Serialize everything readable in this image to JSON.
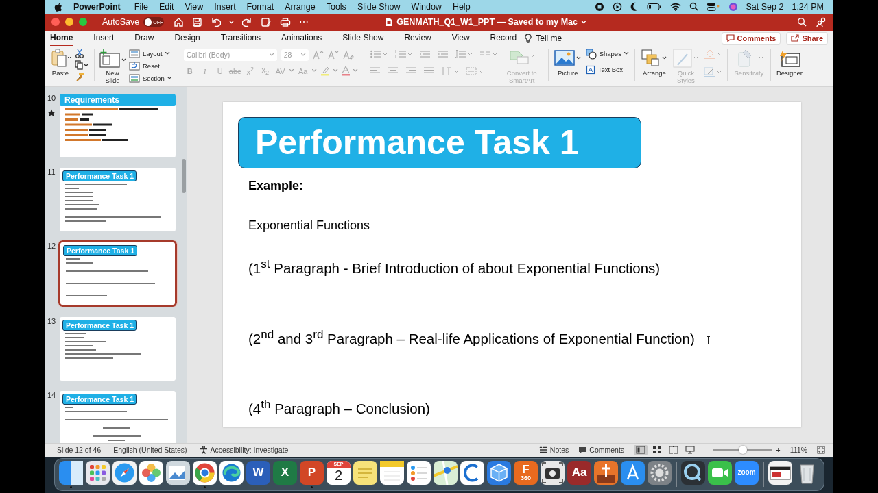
{
  "menu_bar": {
    "app": "PowerPoint",
    "menus": [
      "File",
      "Edit",
      "View",
      "Insert",
      "Format",
      "Arrange",
      "Tools",
      "Slide Show",
      "Window",
      "Help"
    ],
    "date": "Sat Sep 2",
    "time": "1:24 PM"
  },
  "title_bar": {
    "autosave_label": "AutoSave",
    "autosave": {
      "on": false,
      "label": "OFF"
    },
    "more": "⋯",
    "title": "GENMATH_Q1_W1_PPT — Saved to my Mac"
  },
  "ribbon_tabs": [
    {
      "label": "Home",
      "selected": true
    },
    {
      "label": "Insert",
      "selected": false
    },
    {
      "label": "Draw",
      "selected": false
    },
    {
      "label": "Design",
      "selected": false
    },
    {
      "label": "Transitions",
      "selected": false
    },
    {
      "label": "Animations",
      "selected": false
    },
    {
      "label": "Slide Show",
      "selected": false
    },
    {
      "label": "Review",
      "selected": false
    },
    {
      "label": "View",
      "selected": false
    },
    {
      "label": "Record",
      "selected": false
    }
  ],
  "tell_me": "Tell me",
  "comments_button": "Comments",
  "share_button": "Share",
  "ribbon": {
    "paste": "Paste",
    "new_slide": "New Slide",
    "slide_options": [
      "Layout",
      "Reset",
      "Section"
    ],
    "font_name": "Calibri (Body)",
    "font_size": "28",
    "font_disabled": true,
    "format_buttons": [
      "B",
      "I",
      "U",
      "abc",
      "x$^{2}$",
      "x$_{2}$",
      "AV",
      "Aa"
    ],
    "paragraph_disabled": true,
    "smartart": {
      "label": "Convert to SmartArt",
      "disabled": true
    },
    "picture": {
      "label": "Picture",
      "disabled": false
    },
    "shapes": {
      "label": "Shapes",
      "disabled": false
    },
    "text_box": {
      "label": "Text Box",
      "disabled": false
    },
    "arrange": {
      "label": "Arrange",
      "disabled": false
    },
    "quick_styles": {
      "label": "Quick Styles",
      "disabled": true
    },
    "sensitivity": {
      "label": "Sensitivity",
      "disabled": true
    },
    "designer": {
      "label": "Designer",
      "disabled": false
    }
  },
  "slides": [
    {
      "number": "10",
      "selected": false,
      "starred": true,
      "kind": "banner",
      "title": "Requirements"
    },
    {
      "number": "11",
      "selected": false,
      "starred": false,
      "kind": "box",
      "title": "Performance Task 1"
    },
    {
      "number": "12",
      "selected": true,
      "starred": false,
      "kind": "box",
      "title": "Performance Task 1"
    },
    {
      "number": "13",
      "selected": false,
      "starred": false,
      "kind": "box",
      "title": "Performance Task 1"
    },
    {
      "number": "14",
      "selected": false,
      "starred": false,
      "kind": "box",
      "title": "Performance Task 1"
    }
  ],
  "slide": {
    "title": "Performance Task 1",
    "blocks": [
      {
        "kind": "heading",
        "text": "Example:"
      },
      {
        "kind": "subtitle",
        "text": "Exponential Functions"
      },
      {
        "kind": "paragraph",
        "text": "(1$^{st}$ Paragraph - Brief Introduction of about Exponential Functions)"
      },
      {
        "kind": "paragraph",
        "text": "(2$^{nd}$ and 3$^{rd}$ Paragraph – Real-life Applications of Exponential Function)"
      },
      {
        "kind": "paragraph",
        "text": "(4$^{th}$ Paragraph – Conclusion)"
      }
    ]
  },
  "status_bar": {
    "slide_position": "Slide 12 of 46",
    "language": "English (United States)",
    "accessibility": "Accessibility: Investigate",
    "notes": "Notes",
    "comments": "Comments",
    "views": [
      {
        "selected": true
      },
      {
        "selected": false
      },
      {
        "selected": false
      },
      {
        "selected": false
      }
    ],
    "zoom_minus": "-",
    "zoom_plus": "+",
    "zoom": {
      "level": 0.5
    },
    "zoom_percent": "111%"
  },
  "dock": [
    {
      "kind": "app",
      "running": true
    },
    {
      "kind": "app",
      "running": false
    },
    {
      "kind": "app",
      "running": false
    },
    {
      "kind": "app",
      "running": false
    },
    {
      "kind": "app",
      "running": false
    },
    {
      "kind": "app",
      "running": true
    },
    {
      "kind": "app",
      "running": false
    },
    {
      "kind": "letter",
      "text": "W",
      "running": false
    },
    {
      "kind": "letter",
      "text": "X",
      "running": false
    },
    {
      "kind": "letter",
      "text": "P",
      "running": true
    },
    {
      "kind": "calendar",
      "month": "SEP",
      "day": "2",
      "running": false
    },
    {
      "kind": "app",
      "running": false
    },
    {
      "kind": "app",
      "running": false
    },
    {
      "kind": "app",
      "running": false
    },
    {
      "kind": "app",
      "running": false
    },
    {
      "kind": "app",
      "running": false
    },
    {
      "kind": "app",
      "running": false
    },
    {
      "kind": "letter",
      "text": "F",
      "sub": "360",
      "running": false
    },
    {
      "kind": "app",
      "running": false
    },
    {
      "kind": "letter",
      "text": "Aa",
      "running": false
    },
    {
      "kind": "app",
      "running": false
    },
    {
      "kind": "app",
      "running": false
    },
    {
      "kind": "app",
      "running": false
    },
    {
      "kind": "separator"
    },
    {
      "kind": "app",
      "running": false
    },
    {
      "kind": "app",
      "running": false
    },
    {
      "kind": "letter",
      "text": "zoom",
      "running": false
    },
    {
      "kind": "separator"
    },
    {
      "kind": "app",
      "running": false
    },
    {
      "kind": "app",
      "running": false
    }
  ]
}
